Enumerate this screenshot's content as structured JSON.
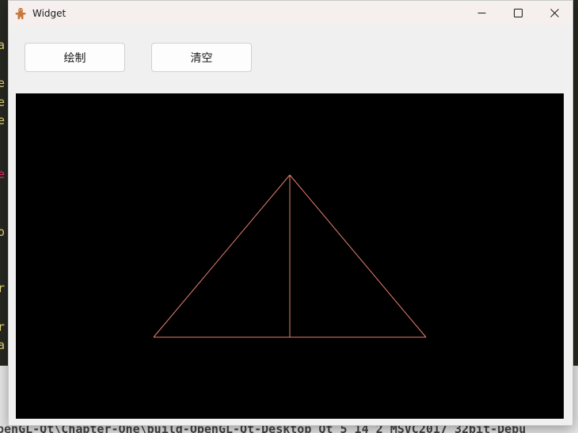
{
  "window": {
    "title": "Widget",
    "app_icon": "gingerbread-icon",
    "controls": [
      "minimize-icon",
      "maximize-icon",
      "close-icon"
    ]
  },
  "toolbar": {
    "draw_label": "绘制",
    "clear_label": "清空"
  },
  "canvas": {
    "background": "#000000",
    "line_color": "#e8806f"
  },
  "background_ide": {
    "margin_chars": [
      "a",
      "e",
      "e",
      "e",
      "e",
      "o",
      "r",
      "r",
      "a"
    ],
    "build_path": "penGL-Qt\\Chapter-One\\build-OpenGL-Qt-Desktop Qt 5 14 2 MSVC2017 32bit-Debu"
  }
}
